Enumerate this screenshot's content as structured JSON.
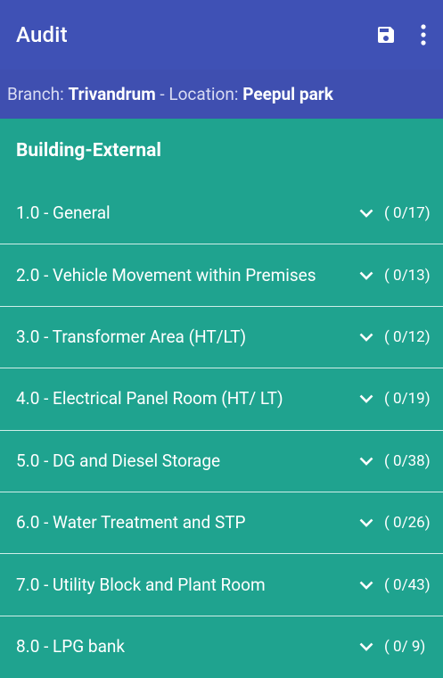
{
  "appbar": {
    "title": "Audit",
    "save_icon": "save-icon",
    "more_icon": "more-vert-icon"
  },
  "subheader": {
    "branch_label": "Branch:",
    "branch_value": "Trivandrum",
    "separator": "-",
    "location_label": "Location:",
    "location_value": "Peepul park"
  },
  "section": {
    "title": "Building-External"
  },
  "items": [
    {
      "label": "1.0 - General",
      "count": "( 0/17)"
    },
    {
      "label": "2.0 - Vehicle Movement within Premises",
      "count": "( 0/13)"
    },
    {
      "label": "3.0 - Transformer Area (HT/LT)",
      "count": "( 0/12)"
    },
    {
      "label": "4.0 - Electrical Panel Room (HT/ LT)",
      "count": "( 0/19)"
    },
    {
      "label": "5.0 - DG and Diesel Storage",
      "count": "( 0/38)"
    },
    {
      "label": "6.0 - Water Treatment and STP",
      "count": "( 0/26)"
    },
    {
      "label": "7.0 - Utility Block and Plant Room",
      "count": "( 0/43)"
    },
    {
      "label": "8.0 - LPG bank",
      "count": "( 0/ 9)"
    }
  ],
  "colors": {
    "appbar": "#3f51b5",
    "subheader": "#3f4fb0",
    "list_bg": "#1fa38f",
    "divider": "#cfeee9"
  }
}
